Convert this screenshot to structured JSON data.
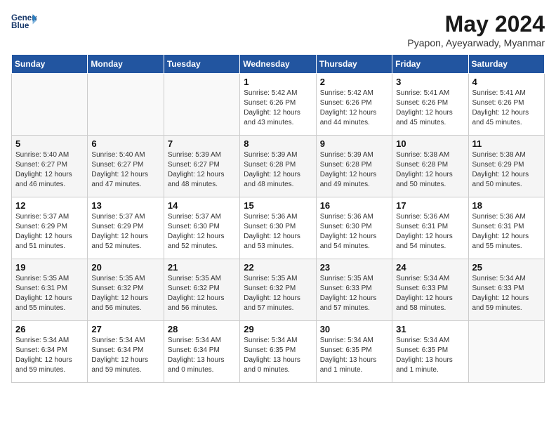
{
  "logo": {
    "line1": "General",
    "line2": "Blue"
  },
  "title": "May 2024",
  "subtitle": "Pyapon, Ayeyarwady, Myanmar",
  "days_of_week": [
    "Sunday",
    "Monday",
    "Tuesday",
    "Wednesday",
    "Thursday",
    "Friday",
    "Saturday"
  ],
  "weeks": [
    [
      {
        "day": "",
        "info": ""
      },
      {
        "day": "",
        "info": ""
      },
      {
        "day": "",
        "info": ""
      },
      {
        "day": "1",
        "info": "Sunrise: 5:42 AM\nSunset: 6:26 PM\nDaylight: 12 hours\nand 43 minutes."
      },
      {
        "day": "2",
        "info": "Sunrise: 5:42 AM\nSunset: 6:26 PM\nDaylight: 12 hours\nand 44 minutes."
      },
      {
        "day": "3",
        "info": "Sunrise: 5:41 AM\nSunset: 6:26 PM\nDaylight: 12 hours\nand 45 minutes."
      },
      {
        "day": "4",
        "info": "Sunrise: 5:41 AM\nSunset: 6:26 PM\nDaylight: 12 hours\nand 45 minutes."
      }
    ],
    [
      {
        "day": "5",
        "info": "Sunrise: 5:40 AM\nSunset: 6:27 PM\nDaylight: 12 hours\nand 46 minutes."
      },
      {
        "day": "6",
        "info": "Sunrise: 5:40 AM\nSunset: 6:27 PM\nDaylight: 12 hours\nand 47 minutes."
      },
      {
        "day": "7",
        "info": "Sunrise: 5:39 AM\nSunset: 6:27 PM\nDaylight: 12 hours\nand 48 minutes."
      },
      {
        "day": "8",
        "info": "Sunrise: 5:39 AM\nSunset: 6:28 PM\nDaylight: 12 hours\nand 48 minutes."
      },
      {
        "day": "9",
        "info": "Sunrise: 5:39 AM\nSunset: 6:28 PM\nDaylight: 12 hours\nand 49 minutes."
      },
      {
        "day": "10",
        "info": "Sunrise: 5:38 AM\nSunset: 6:28 PM\nDaylight: 12 hours\nand 50 minutes."
      },
      {
        "day": "11",
        "info": "Sunrise: 5:38 AM\nSunset: 6:29 PM\nDaylight: 12 hours\nand 50 minutes."
      }
    ],
    [
      {
        "day": "12",
        "info": "Sunrise: 5:37 AM\nSunset: 6:29 PM\nDaylight: 12 hours\nand 51 minutes."
      },
      {
        "day": "13",
        "info": "Sunrise: 5:37 AM\nSunset: 6:29 PM\nDaylight: 12 hours\nand 52 minutes."
      },
      {
        "day": "14",
        "info": "Sunrise: 5:37 AM\nSunset: 6:30 PM\nDaylight: 12 hours\nand 52 minutes."
      },
      {
        "day": "15",
        "info": "Sunrise: 5:36 AM\nSunset: 6:30 PM\nDaylight: 12 hours\nand 53 minutes."
      },
      {
        "day": "16",
        "info": "Sunrise: 5:36 AM\nSunset: 6:30 PM\nDaylight: 12 hours\nand 54 minutes."
      },
      {
        "day": "17",
        "info": "Sunrise: 5:36 AM\nSunset: 6:31 PM\nDaylight: 12 hours\nand 54 minutes."
      },
      {
        "day": "18",
        "info": "Sunrise: 5:36 AM\nSunset: 6:31 PM\nDaylight: 12 hours\nand 55 minutes."
      }
    ],
    [
      {
        "day": "19",
        "info": "Sunrise: 5:35 AM\nSunset: 6:31 PM\nDaylight: 12 hours\nand 55 minutes."
      },
      {
        "day": "20",
        "info": "Sunrise: 5:35 AM\nSunset: 6:32 PM\nDaylight: 12 hours\nand 56 minutes."
      },
      {
        "day": "21",
        "info": "Sunrise: 5:35 AM\nSunset: 6:32 PM\nDaylight: 12 hours\nand 56 minutes."
      },
      {
        "day": "22",
        "info": "Sunrise: 5:35 AM\nSunset: 6:32 PM\nDaylight: 12 hours\nand 57 minutes."
      },
      {
        "day": "23",
        "info": "Sunrise: 5:35 AM\nSunset: 6:33 PM\nDaylight: 12 hours\nand 57 minutes."
      },
      {
        "day": "24",
        "info": "Sunrise: 5:34 AM\nSunset: 6:33 PM\nDaylight: 12 hours\nand 58 minutes."
      },
      {
        "day": "25",
        "info": "Sunrise: 5:34 AM\nSunset: 6:33 PM\nDaylight: 12 hours\nand 59 minutes."
      }
    ],
    [
      {
        "day": "26",
        "info": "Sunrise: 5:34 AM\nSunset: 6:34 PM\nDaylight: 12 hours\nand 59 minutes."
      },
      {
        "day": "27",
        "info": "Sunrise: 5:34 AM\nSunset: 6:34 PM\nDaylight: 12 hours\nand 59 minutes."
      },
      {
        "day": "28",
        "info": "Sunrise: 5:34 AM\nSunset: 6:34 PM\nDaylight: 13 hours\nand 0 minutes."
      },
      {
        "day": "29",
        "info": "Sunrise: 5:34 AM\nSunset: 6:35 PM\nDaylight: 13 hours\nand 0 minutes."
      },
      {
        "day": "30",
        "info": "Sunrise: 5:34 AM\nSunset: 6:35 PM\nDaylight: 13 hours\nand 1 minute."
      },
      {
        "day": "31",
        "info": "Sunrise: 5:34 AM\nSunset: 6:35 PM\nDaylight: 13 hours\nand 1 minute."
      },
      {
        "day": "",
        "info": ""
      }
    ]
  ]
}
